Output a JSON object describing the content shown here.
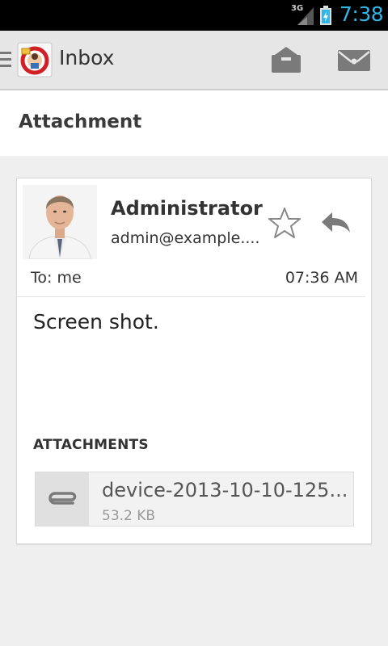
{
  "status_bar": {
    "network": "3G",
    "time": "7:38",
    "clock_color": "#33b5e5"
  },
  "action_bar": {
    "title": "Inbox",
    "icons": [
      "menu-icon",
      "app-logo-icon",
      "archive-icon",
      "mail-icon"
    ]
  },
  "subject": "Attachment",
  "message": {
    "sender_name": "Administrator",
    "sender_email": "admin@example....",
    "to": "To: me",
    "time": "07:36 AM",
    "body": "Screen shot.",
    "attachments_heading": "ATTACHMENTS",
    "attachments": [
      {
        "name": "device-2013-10-10-125...",
        "size": "53.2 KB"
      }
    ]
  },
  "colors": {
    "accent": "#33b5e5",
    "action_bar_bg": "#e6e6e6",
    "page_bg": "#efefef",
    "icon_gray": "#7a7a7a"
  }
}
